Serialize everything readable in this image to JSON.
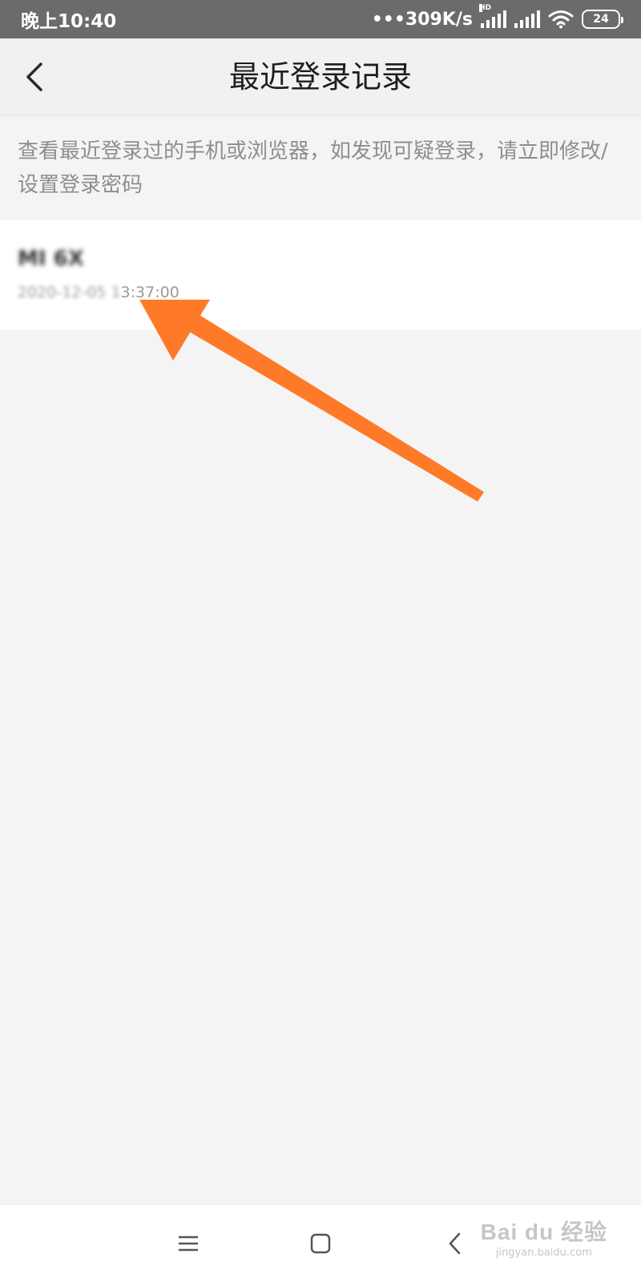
{
  "status_bar": {
    "time": "晚上10:40",
    "net_speed": "•••309K/s",
    "hd_label": "HD",
    "battery": "24",
    "icons": [
      "signal-icon",
      "signal-icon",
      "wifi-icon",
      "battery-icon"
    ]
  },
  "header": {
    "title": "最近登录记录",
    "back_icon": "chevron-left-icon"
  },
  "description": "查看最近登录过的手机或浏览器，如发现可疑登录，请立即修改/设置登录密码",
  "records": [
    {
      "device": "MI 6X",
      "time_blurred": "2020-12-05 1",
      "time_visible": "3:37:00"
    }
  ],
  "nav_bar": {
    "icons": [
      "menu-icon",
      "home-icon",
      "back-icon"
    ]
  },
  "watermark": {
    "main": "Bai du 经验",
    "sub": "jingyan.baidu.com"
  },
  "colors": {
    "status_bar": "#6b6b6b",
    "header_bg": "#f1f1f1",
    "page_bg": "#f4f4f4",
    "arrow": "#ff7a28"
  }
}
